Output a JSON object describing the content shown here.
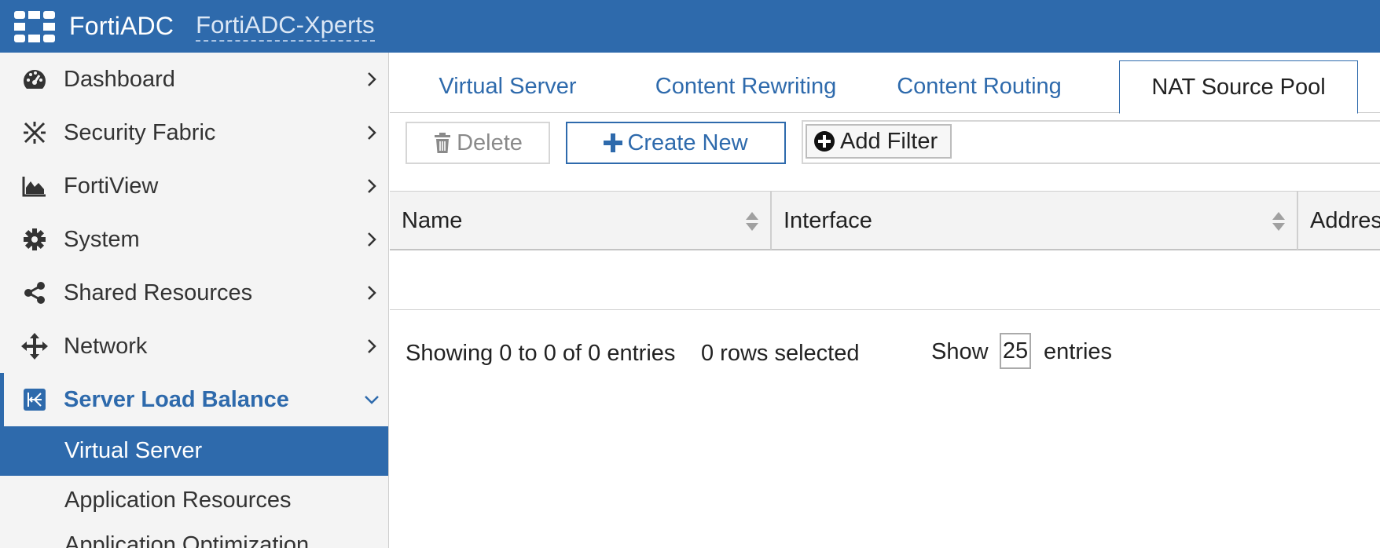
{
  "header": {
    "brand": "FortiADC",
    "host": "FortiADC-Xperts",
    "color": "#2e6aac"
  },
  "sidebar": {
    "items": [
      {
        "label": "Dashboard",
        "icon": "gauge-icon"
      },
      {
        "label": "Security Fabric",
        "icon": "security-fabric-icon"
      },
      {
        "label": "FortiView",
        "icon": "area-chart-icon"
      },
      {
        "label": "System",
        "icon": "gear-icon"
      },
      {
        "label": "Shared Resources",
        "icon": "share-icon"
      },
      {
        "label": "Network",
        "icon": "move-arrows-icon"
      },
      {
        "label": "Server Load Balance",
        "icon": "load-balance-icon",
        "expanded": true
      }
    ],
    "subitems": [
      {
        "label": "Virtual Server",
        "selected": true
      },
      {
        "label": "Application Resources"
      },
      {
        "label": "Application Optimization"
      }
    ]
  },
  "tabs": [
    {
      "label": "Virtual Server"
    },
    {
      "label": "Content Rewriting"
    },
    {
      "label": "Content Routing"
    },
    {
      "label": "NAT Source Pool",
      "active": true
    }
  ],
  "toolbar": {
    "delete_label": "Delete",
    "create_label": "Create New",
    "filter_label": "Add Filter"
  },
  "table": {
    "columns": [
      "Name",
      "Interface",
      "Address"
    ]
  },
  "footer": {
    "showing": "Showing 0 to 0 of 0 entries",
    "selected": "0 rows selected",
    "show_label": "Show",
    "page_size": "25",
    "entries_label": "entries"
  }
}
